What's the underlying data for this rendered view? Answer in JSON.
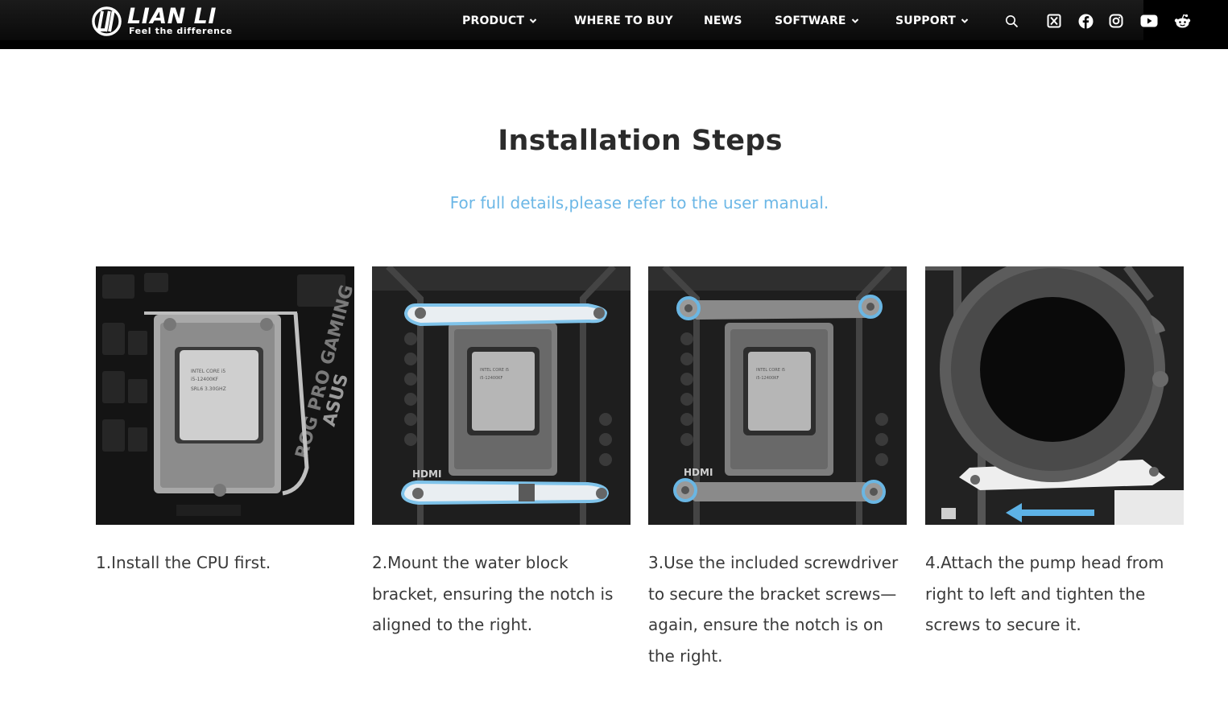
{
  "header": {
    "brand": "LIAN LI",
    "tagline": "Feel the difference",
    "nav": [
      {
        "label": "PRODUCT",
        "has_dropdown": true
      },
      {
        "label": "WHERE TO BUY",
        "has_dropdown": false
      },
      {
        "label": "NEWS",
        "has_dropdown": false
      },
      {
        "label": "SOFTWARE",
        "has_dropdown": true
      },
      {
        "label": "SUPPORT",
        "has_dropdown": true
      }
    ],
    "icons": [
      "search-icon",
      "x-twitter-icon",
      "facebook-icon",
      "instagram-icon",
      "youtube-icon",
      "reddit-icon"
    ]
  },
  "section": {
    "title": "Installation Steps",
    "subtitle": "For full details,please refer to the user manual."
  },
  "steps": [
    {
      "text": "1.Install the CPU first.",
      "image": "cpu-installed-image"
    },
    {
      "text": "2.Mount the water block bracket, ensuring the notch is aligned to the right.",
      "image": "bracket-mounted-image"
    },
    {
      "text": "3.Use the included screwdriver to secure the bracket screws—again, ensure the notch is on the right.",
      "image": "bracket-screws-image"
    },
    {
      "text": "4.Attach the pump head from right to left and tighten the screws to secure it.",
      "image": "pump-head-image"
    }
  ],
  "colors": {
    "header_bg": "#000000",
    "accent": "#6cb7e6",
    "title": "#2b2b2b",
    "body_text": "#3a3a3a"
  }
}
